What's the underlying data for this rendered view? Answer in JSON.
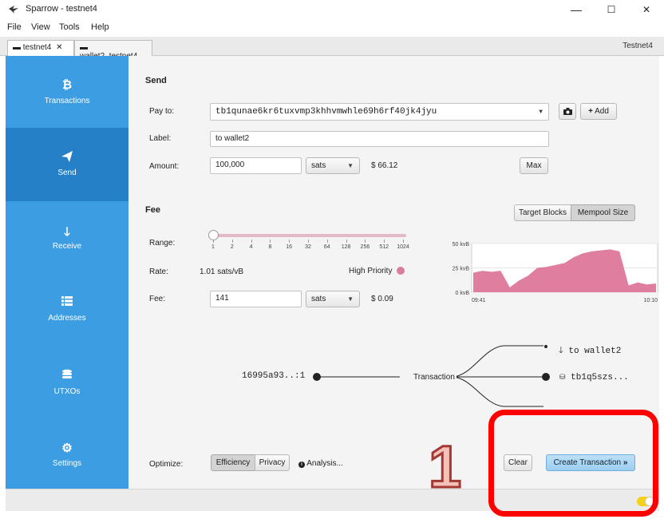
{
  "window": {
    "title": "Sparrow - testnet4",
    "minimize": "—",
    "maximize": "☐",
    "close": "✕"
  },
  "menu": [
    "File",
    "View",
    "Tools",
    "Help"
  ],
  "tabs": [
    {
      "label": "testnet4",
      "close": "✕"
    },
    {
      "label": "wallet2_testnet4"
    }
  ],
  "network_label": "Testnet4",
  "sidebar": [
    {
      "label": "Transactions",
      "icon": "bitcoin-icon"
    },
    {
      "label": "Send",
      "icon": "send-icon"
    },
    {
      "label": "Receive",
      "icon": "arrow-down-icon"
    },
    {
      "label": "Addresses",
      "icon": "list-icon"
    },
    {
      "label": "UTXOs",
      "icon": "coins-icon"
    },
    {
      "label": "Settings",
      "icon": "gear-icon"
    }
  ],
  "send": {
    "heading": "Send",
    "pay_to_label": "Pay to:",
    "pay_to_value": "tb1qunae6kr6tuxvmp3khhvmwhle69h6rf40jk4jyu",
    "add_label": "Add",
    "label_label": "Label:",
    "label_value": "to wallet2",
    "amount_label": "Amount:",
    "amount_value": "100,000",
    "amount_unit": "sats",
    "amount_fiat": "$ 66.12",
    "max_label": "Max"
  },
  "fee": {
    "heading": "Fee",
    "target_blocks_label": "Target Blocks",
    "mempool_size_label": "Mempool Size",
    "range_label": "Range:",
    "range_ticks": [
      "1",
      "2",
      "4",
      "8",
      "16",
      "32",
      "64",
      "128",
      "256",
      "512",
      "1024"
    ],
    "range_position": 0,
    "rate_label": "Rate:",
    "rate_value": "1.01 sats/vB",
    "priority": "High Priority",
    "priority_color": "#d97e9b",
    "fee_label": "Fee:",
    "fee_value": "141",
    "fee_unit": "sats",
    "fee_fiat": "$ 0.09"
  },
  "chart_data": {
    "type": "area",
    "y_ticks": [
      "50 kvB",
      "25 kvB",
      "0 kvB"
    ],
    "ylim": [
      0,
      50
    ],
    "x_ticks": [
      "09:41",
      "10:10"
    ],
    "color": "#e07ea0",
    "values": [
      20,
      22,
      21,
      22,
      5,
      12,
      17,
      25,
      26,
      28,
      30,
      36,
      40,
      42,
      43,
      44,
      42,
      7,
      10,
      8,
      9
    ]
  },
  "diagram": {
    "input": "16995a93..:1",
    "center": "Transaction",
    "outputs": [
      "to wallet2",
      "tb1q5szs..."
    ]
  },
  "footer": {
    "optimize_label": "Optimize:",
    "efficiency_label": "Efficiency",
    "privacy_label": "Privacy",
    "analysis_label": "Analysis...",
    "clear_label": "Clear",
    "create_label": "Create Transaction"
  },
  "annotation": {
    "number": "1",
    "color": "#ff0000"
  }
}
